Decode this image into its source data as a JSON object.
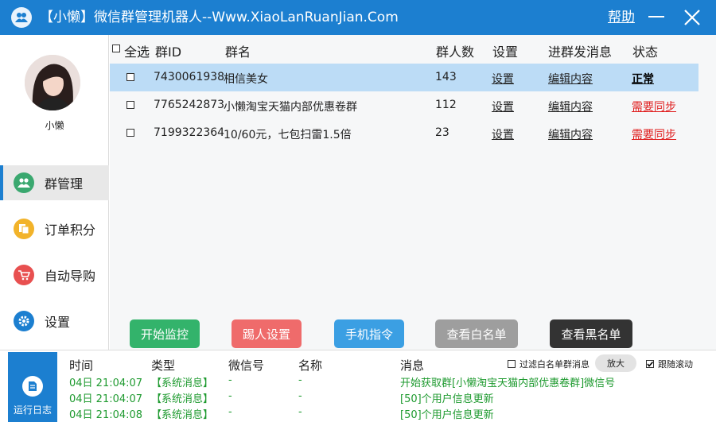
{
  "titlebar": {
    "title": "【小懒】微信群管理机器人--Www.XiaoLanRuanJian.Com",
    "help": "帮助"
  },
  "user": {
    "name": "小懒"
  },
  "sidebar": {
    "items": [
      {
        "label": "群管理",
        "icon": "users-icon",
        "color": "#3aa86f",
        "active": true
      },
      {
        "label": "订单积分",
        "icon": "order-icon",
        "color": "#f2b32a",
        "active": false
      },
      {
        "label": "自动导购",
        "icon": "cart-icon",
        "color": "#e85050",
        "active": false
      },
      {
        "label": "设置",
        "icon": "gear-icon",
        "color": "#1c7fd0",
        "active": false
      }
    ]
  },
  "table": {
    "headers": {
      "select_all": "全选",
      "group_id": "群ID",
      "group_name": "群名",
      "members": "群人数",
      "settings": "设置",
      "welcome": "进群发消息",
      "status": "状态"
    },
    "rows": [
      {
        "id": "7430061938",
        "name": "相信美女",
        "members": "143",
        "settings": "设置",
        "welcome": "编辑内容",
        "status": "正常",
        "status_type": "ok",
        "selected": true
      },
      {
        "id": "7765242873",
        "name": "小懒淘宝天猫内部优惠卷群",
        "members": "112",
        "settings": "设置",
        "welcome": "编辑内容",
        "status": "需要同步",
        "status_type": "warn",
        "selected": false
      },
      {
        "id": "7199322364",
        "name": "10/60元，七包扫雷1.5倍",
        "members": "23",
        "settings": "设置",
        "welcome": "编辑内容",
        "status": "需要同步",
        "status_type": "warn",
        "selected": false
      }
    ]
  },
  "buttons": {
    "start_monitor": "开始监控",
    "kick_settings": "踢人设置",
    "phone_command": "手机指令",
    "view_whitelist": "查看白名单",
    "view_blacklist": "查看黑名单"
  },
  "colors": {
    "accent": "#1c7fd0",
    "start": "#33b36b",
    "kick": "#ef6b6b",
    "phone": "#3b9fe3",
    "whitelist": "#9e9e9e",
    "blacklist": "#333333",
    "log_green": "#1e9a2f"
  },
  "log": {
    "tab_label": "运行日志",
    "headers": {
      "time": "时间",
      "type": "类型",
      "wechat": "微信号",
      "name": "名称",
      "message": "消息"
    },
    "filter_whitelist": "过滤白名单群消息",
    "zoom": "放大",
    "follow_scroll": "跟随滚动",
    "entries": [
      {
        "time": "04日 21:04:07",
        "type": "【系统消息】",
        "wechat": "-",
        "name": "-",
        "message": "开始获取群[小懒淘宝天猫内部优惠卷群]微信号"
      },
      {
        "time": "04日 21:04:07",
        "type": "【系统消息】",
        "wechat": "-",
        "name": "-",
        "message": "[50]个用户信息更新"
      },
      {
        "time": "04日 21:04:08",
        "type": "【系统消息】",
        "wechat": "-",
        "name": "-",
        "message": "[50]个用户信息更新"
      }
    ]
  }
}
